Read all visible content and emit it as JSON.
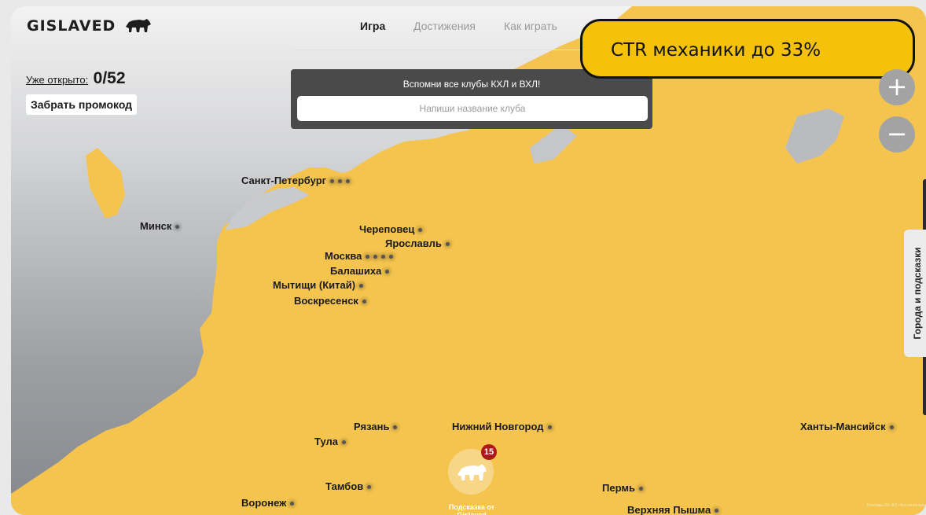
{
  "brand": {
    "logo_text": "GISLAVED"
  },
  "nav": {
    "items": [
      {
        "label": "Игра",
        "active": true
      },
      {
        "label": "Достижения",
        "active": false
      },
      {
        "label": "Как играть",
        "active": false
      }
    ]
  },
  "progress": {
    "label": "Уже открыто:",
    "value": "0/52"
  },
  "promo_button": {
    "label": "Забрать промокод"
  },
  "quiz": {
    "title": "Вспомни все клубы КХЛ и ВХЛ!",
    "input_placeholder": "Напиши название клуба"
  },
  "callout": {
    "text": "CTR механики до 33%"
  },
  "zoom": {
    "in": "+",
    "out": "−"
  },
  "side_tab": {
    "label": "Города и подсказки"
  },
  "cities": [
    {
      "name": "Санкт-Петербург",
      "dots": 3
    },
    {
      "name": "Минск",
      "dots": 1
    },
    {
      "name": "Череповец",
      "dots": 1
    },
    {
      "name": "Ярославль",
      "dots": 1
    },
    {
      "name": "Москва",
      "dots": 4
    },
    {
      "name": "Балашиха",
      "dots": 1
    },
    {
      "name": "Мытищи (Китай)",
      "dots": 1
    },
    {
      "name": "Воскресенск",
      "dots": 1
    },
    {
      "name": "Рязань",
      "dots": 1
    },
    {
      "name": "Нижний Новгород",
      "dots": 1
    },
    {
      "name": "Ханты-Мансийск",
      "dots": 1
    },
    {
      "name": "Тула",
      "dots": 1
    },
    {
      "name": "Тамбов",
      "dots": 1
    },
    {
      "name": "Пермь",
      "dots": 1
    },
    {
      "name": "Воронеж",
      "dots": 1
    },
    {
      "name": "Верхняя Пышма",
      "dots": 1
    }
  ],
  "hint": {
    "badge": "15",
    "label": "Подсказка от Gislaved"
  },
  "ad_note": "Реклама 18+ АО «Континентал»",
  "colors": {
    "land": "#f4c44e",
    "callout": "#f4c20b",
    "badge": "#b0171c"
  },
  "icons": {
    "logo": "bear-icon",
    "hint": "bear-icon",
    "zoom_in": "plus-icon",
    "zoom_out": "minus-icon"
  }
}
